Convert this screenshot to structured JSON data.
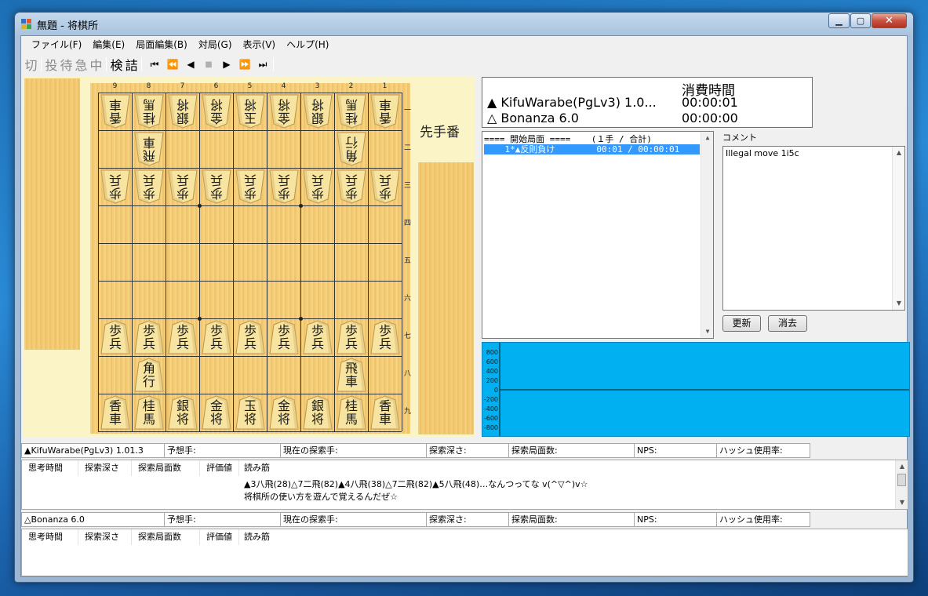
{
  "window": {
    "title": "無題 - 将棋所",
    "minimize_label": "▁",
    "maximize_label": "▢",
    "close_label": "✕"
  },
  "menu": [
    "ファイル(F)",
    "編集(E)",
    "局面編集(B)",
    "対局(G)",
    "表示(V)",
    "ヘルプ(H)"
  ],
  "toolbar": {
    "cut": "切",
    "resign": "投",
    "wait": "待",
    "hurry": "急",
    "stop": "中",
    "kenshou": "検",
    "tsume": "詰",
    "first": "⏮",
    "prev_fast": "⏪",
    "prev": "◀",
    "halt": "■",
    "next": "▶",
    "next_fast": "⏩",
    "last": "⏭"
  },
  "board": {
    "files": [
      "9",
      "8",
      "7",
      "6",
      "5",
      "4",
      "3",
      "2",
      "1"
    ],
    "ranks": [
      "一",
      "二",
      "三",
      "四",
      "五",
      "六",
      "七",
      "八",
      "九"
    ],
    "turn_label": "先手番",
    "pieces": [
      {
        "file": 9,
        "rank": 1,
        "chars": "香車",
        "side": "gote"
      },
      {
        "file": 8,
        "rank": 1,
        "chars": "桂馬",
        "side": "gote"
      },
      {
        "file": 7,
        "rank": 1,
        "chars": "銀将",
        "side": "gote"
      },
      {
        "file": 6,
        "rank": 1,
        "chars": "金将",
        "side": "gote"
      },
      {
        "file": 5,
        "rank": 1,
        "chars": "玉将",
        "side": "gote"
      },
      {
        "file": 4,
        "rank": 1,
        "chars": "金将",
        "side": "gote"
      },
      {
        "file": 3,
        "rank": 1,
        "chars": "銀将",
        "side": "gote"
      },
      {
        "file": 2,
        "rank": 1,
        "chars": "桂馬",
        "side": "gote"
      },
      {
        "file": 1,
        "rank": 1,
        "chars": "香車",
        "side": "gote"
      },
      {
        "file": 8,
        "rank": 2,
        "chars": "飛車",
        "side": "gote"
      },
      {
        "file": 2,
        "rank": 2,
        "chars": "角行",
        "side": "gote"
      },
      {
        "file": 9,
        "rank": 3,
        "chars": "歩兵",
        "side": "gote"
      },
      {
        "file": 8,
        "rank": 3,
        "chars": "歩兵",
        "side": "gote"
      },
      {
        "file": 7,
        "rank": 3,
        "chars": "歩兵",
        "side": "gote"
      },
      {
        "file": 6,
        "rank": 3,
        "chars": "歩兵",
        "side": "gote"
      },
      {
        "file": 5,
        "rank": 3,
        "chars": "歩兵",
        "side": "gote"
      },
      {
        "file": 4,
        "rank": 3,
        "chars": "歩兵",
        "side": "gote"
      },
      {
        "file": 3,
        "rank": 3,
        "chars": "歩兵",
        "side": "gote"
      },
      {
        "file": 2,
        "rank": 3,
        "chars": "歩兵",
        "side": "gote"
      },
      {
        "file": 1,
        "rank": 3,
        "chars": "歩兵",
        "side": "gote"
      },
      {
        "file": 9,
        "rank": 7,
        "chars": "歩兵",
        "side": "sente"
      },
      {
        "file": 8,
        "rank": 7,
        "chars": "歩兵",
        "side": "sente"
      },
      {
        "file": 7,
        "rank": 7,
        "chars": "歩兵",
        "side": "sente"
      },
      {
        "file": 6,
        "rank": 7,
        "chars": "歩兵",
        "side": "sente"
      },
      {
        "file": 5,
        "rank": 7,
        "chars": "歩兵",
        "side": "sente"
      },
      {
        "file": 4,
        "rank": 7,
        "chars": "歩兵",
        "side": "sente"
      },
      {
        "file": 3,
        "rank": 7,
        "chars": "歩兵",
        "side": "sente"
      },
      {
        "file": 2,
        "rank": 7,
        "chars": "歩兵",
        "side": "sente"
      },
      {
        "file": 1,
        "rank": 7,
        "chars": "歩兵",
        "side": "sente"
      },
      {
        "file": 8,
        "rank": 8,
        "chars": "角行",
        "side": "sente"
      },
      {
        "file": 2,
        "rank": 8,
        "chars": "飛車",
        "side": "sente"
      },
      {
        "file": 9,
        "rank": 9,
        "chars": "香車",
        "side": "sente"
      },
      {
        "file": 8,
        "rank": 9,
        "chars": "桂馬",
        "side": "sente"
      },
      {
        "file": 7,
        "rank": 9,
        "chars": "銀将",
        "side": "sente"
      },
      {
        "file": 6,
        "rank": 9,
        "chars": "金将",
        "side": "sente"
      },
      {
        "file": 5,
        "rank": 9,
        "chars": "玉将",
        "side": "sente"
      },
      {
        "file": 4,
        "rank": 9,
        "chars": "金将",
        "side": "sente"
      },
      {
        "file": 3,
        "rank": 9,
        "chars": "銀将",
        "side": "sente"
      },
      {
        "file": 2,
        "rank": 9,
        "chars": "桂馬",
        "side": "sente"
      },
      {
        "file": 1,
        "rank": 9,
        "chars": "香車",
        "side": "sente"
      }
    ]
  },
  "time": {
    "header": "消費時間",
    "sente_name": "▲ KifuWarabe(PgLv3) 1.0...",
    "sente_time": "00:00:01",
    "gote_name": "△ Bonanza 6.0",
    "gote_time": "00:00:00"
  },
  "kifu": [
    "==== 開始局面 ====    (１手 / 合計)",
    "    1*▲反則負け        00:01 / 00:00:01"
  ],
  "comment": {
    "title": "コメント",
    "text": "Illegal move 1i5c",
    "update_label": "更新",
    "clear_label": "消去"
  },
  "graph": {
    "y_labels": [
      "800",
      "600",
      "400",
      "200",
      "0",
      "-200",
      "-400",
      "-600",
      "-800"
    ]
  },
  "engine1": {
    "info": [
      "▲KifuWarabe(PgLv3) 1.01.3",
      "予想手:",
      "現在の探索手:",
      "探索深さ:",
      "探索局面数:",
      "NPS:",
      "ハッシュ使用率:"
    ],
    "headers": [
      "思考時間",
      "探索深さ",
      "探索局面数",
      "評価値",
      "読み筋"
    ],
    "lines": [
      "▲3八飛(28)△7二飛(82)▲4八飛(38)△7二飛(82)▲5八飛(48)…なんつってな v(^▽^)v☆",
      "将棋所の使い方を遊んで覚えるんだぜ☆"
    ]
  },
  "engine2": {
    "info": [
      "△Bonanza 6.0",
      "予想手:",
      "現在の探索手:",
      "探索深さ:",
      "探索局面数:",
      "NPS:",
      "ハッシュ使用率:"
    ],
    "headers": [
      "思考時間",
      "探索深さ",
      "探索局面数",
      "評価値",
      "読み筋"
    ],
    "lines": []
  }
}
